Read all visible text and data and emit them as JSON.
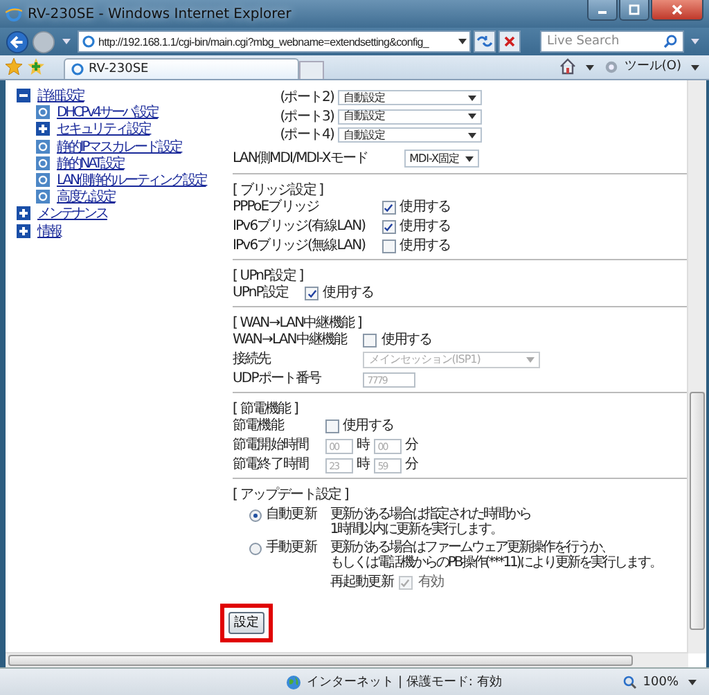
{
  "window": {
    "title": "RV-230SE - Windows Internet Explorer"
  },
  "toolbar": {
    "url": "http://192.168.1.1/cgi-bin/main.cgi?mbg_webname=extendsetting&config_",
    "search_placeholder": "Live Search"
  },
  "tabs": [
    {
      "label": "RV-230SE",
      "selected": true
    }
  ],
  "tools_menu": "ツール(O)",
  "sidebar": {
    "items": [
      {
        "label": "詳細設定",
        "kind": "folder",
        "expanded": true,
        "children": [
          {
            "label": "DHCPv4サーバ設定",
            "kind": "page"
          },
          {
            "label": "セキュリティ設定",
            "kind": "folder",
            "expanded": false
          },
          {
            "label": "静的IPマスカレード設定",
            "kind": "page"
          },
          {
            "label": "静的NAT設定",
            "kind": "page"
          },
          {
            "label": "LAN側静的ルーティング設定",
            "kind": "page"
          },
          {
            "label": "高度な設定",
            "kind": "page"
          }
        ]
      },
      {
        "label": "メンテナンス",
        "kind": "folder",
        "expanded": false
      },
      {
        "label": "情報",
        "kind": "folder",
        "expanded": false
      }
    ]
  },
  "ports": [
    {
      "label": "(ポート2)",
      "value": "自動設定"
    },
    {
      "label": "(ポート3)",
      "value": "自動設定"
    },
    {
      "label": "(ポート4)",
      "value": "自動設定"
    }
  ],
  "mdi_mode": {
    "label": "LAN側MDI/MDI-Xモード",
    "value": "MDI-X固定"
  },
  "sections": [
    {
      "title": "[ ブリッジ設定 ]",
      "rows": [
        {
          "kind": "checkbox",
          "label": "PPPoEブリッジ",
          "option": "使用する",
          "checked": true
        },
        {
          "kind": "checkbox",
          "label": "IPv6ブリッジ(有線LAN)",
          "option": "使用する",
          "checked": true
        },
        {
          "kind": "checkbox",
          "label": "IPv6ブリッジ(無線LAN)",
          "option": "使用する",
          "checked": false
        }
      ]
    },
    {
      "title": "[ UPnP設定 ]",
      "rows": [
        {
          "kind": "checkbox",
          "label": "UPnP設定",
          "option": "使用する",
          "checked": true
        }
      ]
    },
    {
      "title": "[ WAN→LAN中継機能 ]",
      "rows": [
        {
          "kind": "checkbox",
          "label": "WAN→LAN中継機能",
          "option": "使用する",
          "checked": false
        },
        {
          "kind": "select",
          "label": "接続先",
          "value": "メインセッション(ISP1)",
          "disabled": true
        },
        {
          "kind": "input",
          "label": "UDPポート番号",
          "value": "7779",
          "disabled": true
        }
      ]
    },
    {
      "title": "[ 節電機能 ]",
      "rows": [
        {
          "kind": "checkbox",
          "label": "節電機能",
          "option": "使用する",
          "checked": false
        },
        {
          "kind": "time",
          "label": "節電開始時間",
          "hour": "00",
          "hour_unit": "時",
          "minute": "00",
          "minute_unit": "分",
          "disabled": true
        },
        {
          "kind": "time",
          "label": "節電終了時間",
          "hour": "23",
          "hour_unit": "時",
          "minute": "59",
          "minute_unit": "分",
          "disabled": true
        }
      ]
    }
  ],
  "update": {
    "title": "[ アップデート設定 ]",
    "options": [
      {
        "label": "自動更新",
        "selected": true,
        "lines": [
          "更新がある場合は指定された時間から",
          "1時間以内に更新を実行します。"
        ]
      },
      {
        "label": "手動更新",
        "selected": false,
        "lines": [
          "更新がある場合はファームウェア更新操作を行うか、",
          "もしくは電話機からのPB操作(***11)により更新を実行します。"
        ]
      }
    ],
    "restart": {
      "label": "再起動更新",
      "option": "有効",
      "checked": true,
      "disabled": true
    }
  },
  "submit": {
    "label": "設定",
    "highlighted": true
  },
  "status_bar": {
    "zone": "インターネット | 保護モード: 有効",
    "zoom": "100%"
  }
}
